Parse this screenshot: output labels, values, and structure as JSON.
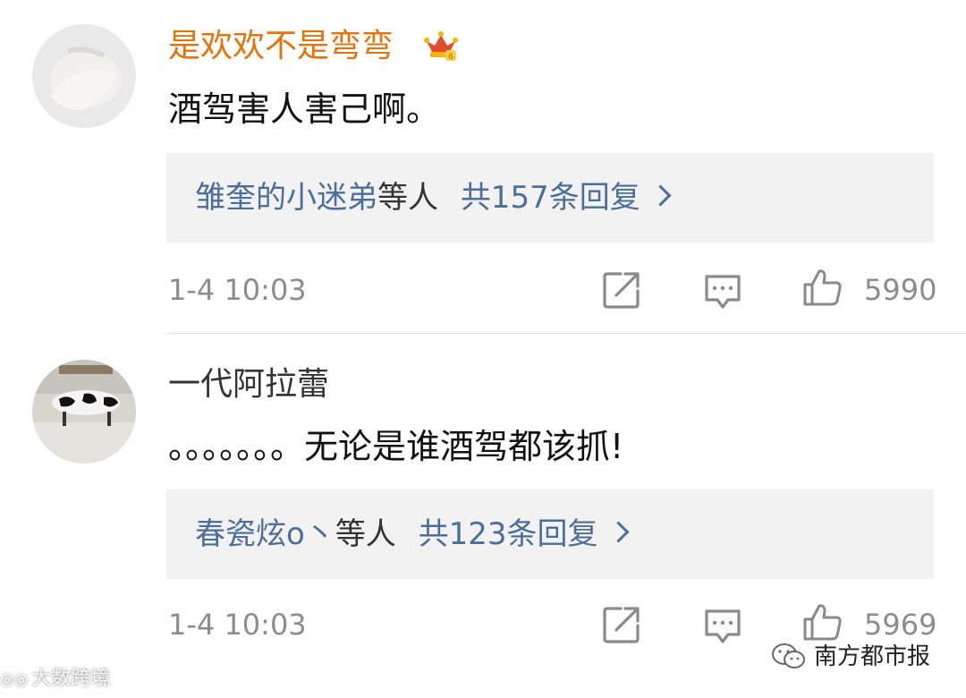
{
  "comments": [
    {
      "username": "是欢欢不是弯弯",
      "is_vip": true,
      "content": "酒驾害人害己啊。",
      "reply_preview": {
        "user": "雏奎的小迷弟",
        "mid": "等人",
        "count_text": "共157条回复"
      },
      "time": "1-4 10:03",
      "likes": "5990"
    },
    {
      "username": "一代阿拉蕾",
      "is_vip": false,
      "content": "。。。。。。。无论是谁酒驾都该抓!",
      "reply_preview": {
        "user": "春瓷炫o丶",
        "mid": "等人",
        "count_text": "共123条回复"
      },
      "time": "1-4 10:03",
      "likes": "5969"
    }
  ],
  "watermarks": {
    "left": "大数跨境",
    "right": "南方都市报"
  },
  "colors": {
    "vip_name": "#e8710a",
    "reply_link": "#4a6f9c",
    "meta": "#8c8c8c",
    "reply_bg": "#f2f2f2"
  },
  "icons": [
    "repost-icon",
    "comment-icon",
    "like-icon",
    "crown-icon"
  ]
}
